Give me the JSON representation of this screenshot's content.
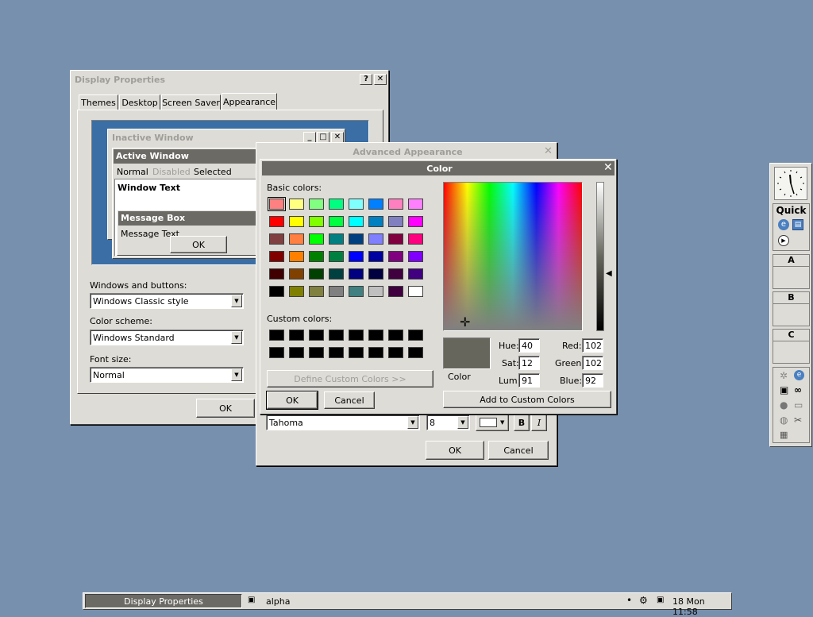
{
  "display_props": {
    "title": "Display Properties",
    "tabs": [
      "Themes",
      "Desktop",
      "Screen Saver",
      "Appearance"
    ],
    "preview": {
      "inactive_title": "Inactive Window",
      "active_title": "Active Window",
      "menu": [
        "Normal",
        "Disabled",
        "Selected"
      ],
      "window_text": "Window Text",
      "msgbox_title": "Message Box",
      "msgbox_text": "Message Text",
      "ok": "OK"
    },
    "windows_buttons_label": "Windows and buttons:",
    "windows_buttons_value": "Windows Classic style",
    "color_scheme_label": "Color scheme:",
    "color_scheme_value": "Windows Standard",
    "font_size_label": "Font size:",
    "font_size_value": "Normal",
    "ok": "OK"
  },
  "advanced": {
    "title": "Advanced Appearance",
    "font_value": "Tahoma",
    "size_value": "8",
    "bold": "B",
    "italic": "I",
    "ok": "OK",
    "cancel": "Cancel"
  },
  "color_dialog": {
    "title": "Color",
    "basic_label": "Basic colors:",
    "custom_label": "Custom colors:",
    "define_custom": "Define Custom Colors >>",
    "ok": "OK",
    "cancel": "Cancel",
    "add_custom": "Add to Custom Colors",
    "color_label": "Color",
    "hue_label": "Hue:",
    "hue": "40",
    "sat_label": "Sat:",
    "sat": "12",
    "lum_label": "Lum:",
    "lum": "91",
    "red_label": "Red:",
    "red": "102",
    "green_label": "Green:",
    "green": "102",
    "blue_label": "Blue:",
    "blue": "92",
    "current_color": "#66665c",
    "basic_colors": [
      "#ff8080",
      "#ffff80",
      "#80ff80",
      "#00ff80",
      "#80ffff",
      "#0080ff",
      "#ff80c0",
      "#ff80ff",
      "#ff0000",
      "#ffff00",
      "#80ff00",
      "#00ff40",
      "#00ffff",
      "#0080c0",
      "#8080c0",
      "#ff00ff",
      "#804040",
      "#ff8040",
      "#00ff00",
      "#008080",
      "#004080",
      "#8080ff",
      "#800040",
      "#ff0080",
      "#800000",
      "#ff8000",
      "#008000",
      "#008040",
      "#0000ff",
      "#0000a0",
      "#800080",
      "#8000ff",
      "#400000",
      "#804000",
      "#004000",
      "#004040",
      "#000080",
      "#000040",
      "#400040",
      "#400080",
      "#000000",
      "#808000",
      "#808040",
      "#808080",
      "#408080",
      "#c0c0c0",
      "#400040",
      "#ffffff"
    ],
    "custom_colors": [
      "#000000",
      "#000000",
      "#000000",
      "#000000",
      "#000000",
      "#000000",
      "#000000",
      "#000000",
      "#000000",
      "#000000",
      "#000000",
      "#000000",
      "#000000",
      "#000000",
      "#000000",
      "#000000"
    ]
  },
  "dock": {
    "quick_label": "Quick",
    "desks": [
      "A",
      "B",
      "C"
    ]
  },
  "taskbar": {
    "active_task": "Display Properties",
    "desktop_name": "alpha",
    "clock": "18 Mon 11:58"
  }
}
